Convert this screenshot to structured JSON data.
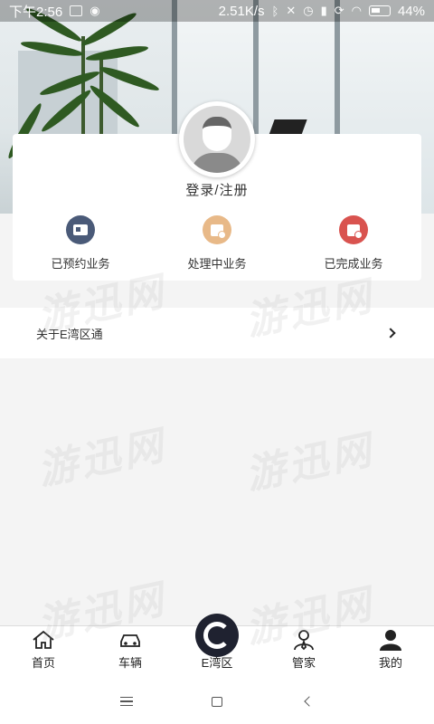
{
  "status_bar": {
    "time": "下午2:56",
    "net_speed": "2.51K/s",
    "battery": "44%"
  },
  "profile": {
    "login_label": "登录/注册"
  },
  "business": [
    {
      "label": "已预约业务",
      "icon": "id-card-icon",
      "color": "#4a5a78"
    },
    {
      "label": "处理中业务",
      "icon": "calendar-clock-icon",
      "color": "#e8b988"
    },
    {
      "label": "已完成业务",
      "icon": "calendar-check-icon",
      "color": "#d9534f"
    }
  ],
  "about": {
    "label": "关于E湾区通"
  },
  "tabs": [
    {
      "label": "首页",
      "icon": "home-icon"
    },
    {
      "label": "车辆",
      "icon": "car-icon"
    },
    {
      "label": "E湾区",
      "icon": "e-bay-logo-icon"
    },
    {
      "label": "管家",
      "icon": "butler-icon"
    },
    {
      "label": "我的",
      "icon": "user-icon",
      "active": true
    }
  ],
  "watermark": "游迅网"
}
